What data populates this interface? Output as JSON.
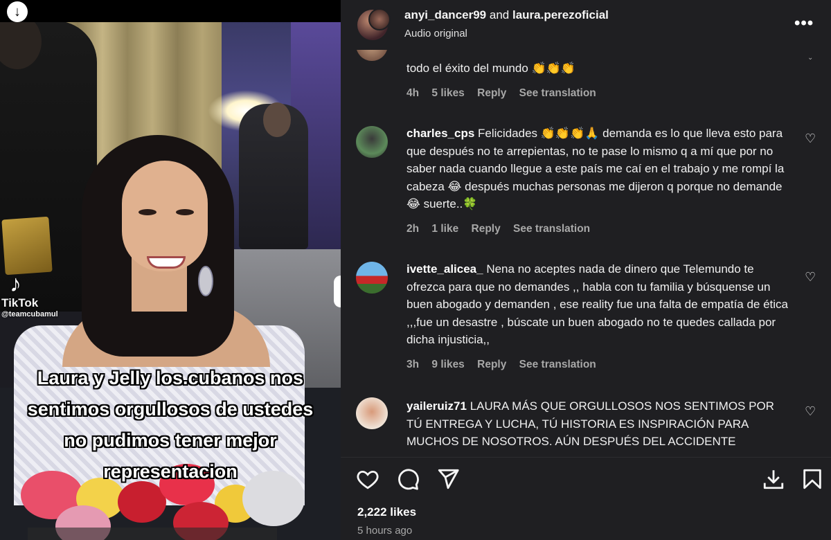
{
  "video": {
    "download_icon": "arrow-down-circle-icon",
    "watermark": {
      "logo_icon": "tiktok-logo-icon",
      "brand": "TikTok",
      "handle": "@teamcubamul"
    },
    "caption": "Laura y Jelly los.cubanos nos sentimos orgullosos de ustedes no pudimos tener mejor representacion"
  },
  "header": {
    "user1": "anyi_dancer99",
    "connector": "and",
    "user2": "laura.perezoficial",
    "audio": "Audio original",
    "more_icon": "more-horizontal-icon"
  },
  "comments": [
    {
      "user": "",
      "text": "todo el éxito del mundo 👏👏👏",
      "time": "4h",
      "likes": "5 likes",
      "reply": "Reply",
      "translate": "See translation",
      "has_heart": false
    },
    {
      "user": "charles_cps",
      "text": "Felicidades 👏👏👏🙏 demanda es lo que lleva esto para que después no te arrepientas, no te pase lo mismo q a mí que por no saber nada cuando llegue a este país me caí en el trabajo y me rompí la cabeza 😂 después muchas personas me dijeron q porque no demande 😂 suerte..🍀",
      "time": "2h",
      "likes": "1 like",
      "reply": "Reply",
      "translate": "See translation",
      "has_heart": true
    },
    {
      "user": "ivette_alicea_",
      "text": "Nena no aceptes nada de dinero que Telemundo te ofrezca para que no demandes ,, habla con tu familia y búsquense un buen abogado y demanden , ese reality fue una falta de empatía de ética ,,,fue un desastre , búscate un buen abogado no te quedes callada por dicha injusticia,,",
      "time": "3h",
      "likes": "9 likes",
      "reply": "Reply",
      "translate": "See translation",
      "has_heart": true
    },
    {
      "user": "yaileruiz71",
      "text": "LAURA MÁS QUE ORGULLOSOS NOS SENTIMOS POR TÚ ENTREGA Y LUCHA, TÚ HISTORIA ES INSPIRACIÓN PARA MUCHOS DE NOSOTROS. AÚN DESPUÉS DEL ACCIDENTE",
      "has_heart": true
    }
  ],
  "actions": {
    "like_icon": "heart-icon",
    "comment_icon": "comment-icon",
    "share_icon": "share-icon",
    "download_icon": "download-icon",
    "save_icon": "bookmark-icon"
  },
  "stats": {
    "likes": "2,222 likes",
    "ago": "5 hours ago"
  }
}
